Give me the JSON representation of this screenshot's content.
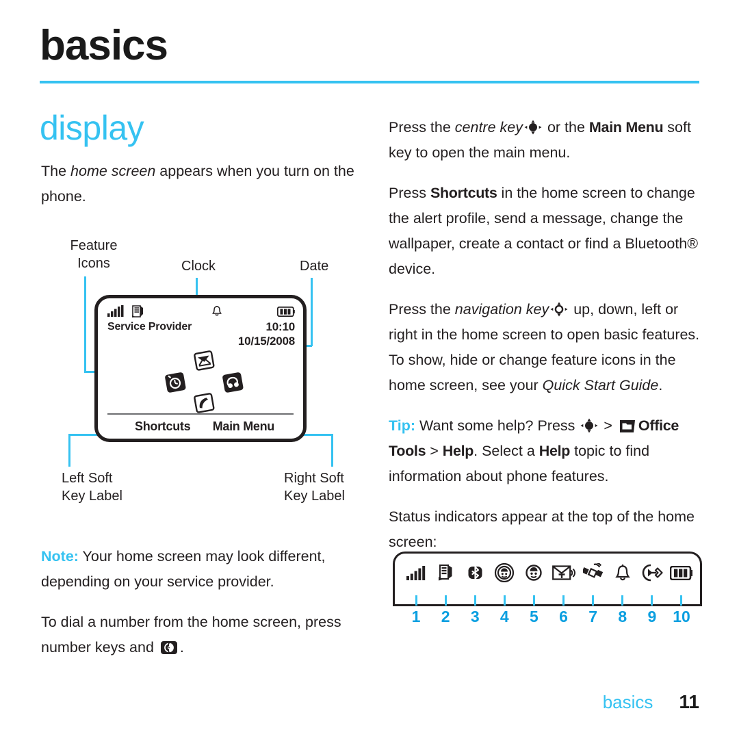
{
  "header": {
    "page_title": "basics",
    "section_title": "display"
  },
  "left_column": {
    "intro": {
      "prefix": "The ",
      "italic": "home screen",
      "suffix": " appears when you turn on the phone."
    },
    "note": {
      "label": "Note:",
      "text": " Your home screen may look different, depending on your service provider."
    },
    "dial": {
      "part1": "To dial a number from the home screen, press number keys and ",
      "icon": "send-key-icon",
      "part2": "."
    }
  },
  "right_column": {
    "para_centre_key": {
      "p1": "Press the ",
      "italic": "centre key",
      "icon": "centre-key-icon",
      "p2": " or the ",
      "bold": "Main Menu",
      "p3": " soft key to open the main menu."
    },
    "para_shortcuts": {
      "p1": "Press ",
      "bold": "Shortcuts",
      "p2": " in the home screen to change the alert profile, send a message, change the wallpaper, create a contact or find a Bluetooth® device."
    },
    "para_navigation": {
      "p1": "Press the ",
      "italic": "navigation key",
      "icon": "navigation-key-icon",
      "p2": " up, down, left or right in the home screen to open basic features. To show, hide or change feature icons in the home screen, see your ",
      "italic2": "Quick Start Guide",
      "p3": "."
    },
    "para_tip": {
      "label": "Tip:",
      "p1": " Want some help? Press ",
      "icon": "centre-key-icon",
      "p2": " > ",
      "icon2": "office-tools-icon",
      "bold1": "Office Tools",
      "p3": " > ",
      "bold2": "Help",
      "p4": ". Select a ",
      "bold3": "Help",
      "p5": " topic to find information about phone features."
    },
    "para_status": "Status indicators appear at the top of the home screen:"
  },
  "diagram": {
    "callouts": {
      "feature_icons": "Feature\nIcons",
      "clock": "Clock",
      "date": "Date",
      "left_soft": "Left Soft\nKey Label",
      "right_soft": "Right Soft\nKey Label"
    },
    "phone_screen": {
      "service_provider": "Service Provider",
      "clock_value": "10:10",
      "date_value": "10/15/2008",
      "left_soft_key": "Shortcuts",
      "right_soft_key": "Main Menu",
      "status_icons": [
        "signal-strength-icon",
        "roaming-icon",
        "alert-bell-icon",
        "battery-icon"
      ],
      "feature_icons": [
        "message-envelope-icon",
        "alarm-clock-icon",
        "music-headset-icon",
        "phone-handset-icon"
      ]
    }
  },
  "indicators": {
    "icons": [
      {
        "num": "1",
        "name": "signal-strength-icon"
      },
      {
        "num": "2",
        "name": "roaming-icon"
      },
      {
        "num": "3",
        "name": "bluetooth-icon"
      },
      {
        "num": "4",
        "name": "active-line-icon"
      },
      {
        "num": "5",
        "name": "contact-face-icon"
      },
      {
        "num": "6",
        "name": "text-message-icon"
      },
      {
        "num": "7",
        "name": "gps-satellite-icon"
      },
      {
        "num": "8",
        "name": "alert-bell-icon"
      },
      {
        "num": "9",
        "name": "call-forward-icon"
      },
      {
        "num": "10",
        "name": "battery-icon"
      }
    ],
    "numbers": [
      "1",
      "2",
      "3",
      "4",
      "5",
      "6",
      "7",
      "8",
      "9",
      "10"
    ]
  },
  "footer": {
    "label": "basics",
    "page_number": "11"
  },
  "colors": {
    "accent": "#35c2f1",
    "accent_number": "#0b9fe0",
    "ink": "#231f20"
  }
}
